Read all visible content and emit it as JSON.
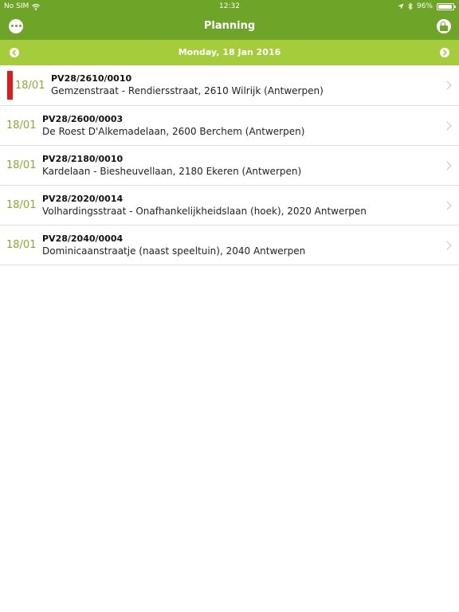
{
  "status_bar": {
    "carrier": "No SIM",
    "time": "12:32",
    "battery_level": "96%",
    "battery_fraction": 0.96
  },
  "nav": {
    "title": "Planning",
    "menu_icon": "more-dots-icon",
    "lock_icon": "lock-icon"
  },
  "date_bar": {
    "date": "Monday, 18 Jan 2016"
  },
  "colors": {
    "nav_green": "#6ea428",
    "date_bar_green": "#a5cd3b",
    "date_text_green": "#8aab2c",
    "flag_red": "#e11919"
  },
  "items": [
    {
      "date": "18/01",
      "code": "PV28/2610/0010",
      "address": "Gemzenstraat - Rendiersstraat, 2610 Wilrijk (Antwerpen)",
      "flagged": true
    },
    {
      "date": "18/01",
      "code": "PV28/2600/0003",
      "address": "De Roest D'Alkemadelaan, 2600 Berchem (Antwerpen)",
      "flagged": false
    },
    {
      "date": "18/01",
      "code": "PV28/2180/0010",
      "address": "Kardelaan - Biesheuvellaan, 2180 Ekeren (Antwerpen)",
      "flagged": false
    },
    {
      "date": "18/01",
      "code": "PV28/2020/0014",
      "address": "Volhardingsstraat - Onafhankelijkheidslaan (hoek), 2020 Antwerpen",
      "flagged": false
    },
    {
      "date": "18/01",
      "code": "PV28/2040/0004",
      "address": "Dominicaanstraatje (naast speeltuin), 2040 Antwerpen",
      "flagged": false
    }
  ]
}
